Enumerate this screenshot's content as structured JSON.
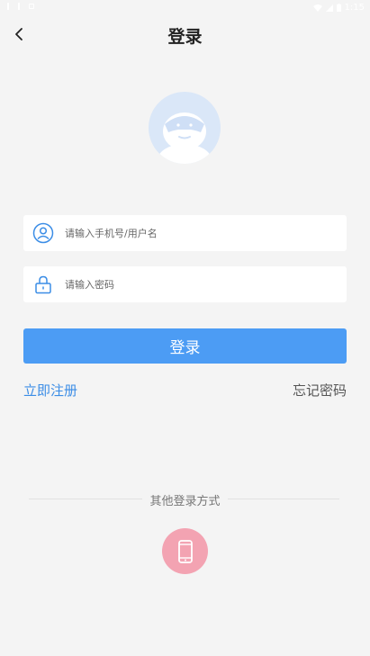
{
  "status_bar": {
    "time": "1:15"
  },
  "header": {
    "title": "登录"
  },
  "form": {
    "username": {
      "placeholder": "请输入手机号/用户名",
      "value": ""
    },
    "password": {
      "placeholder": "请输入密码",
      "value": ""
    },
    "login_label": "登录"
  },
  "links": {
    "register": "立即注册",
    "forgot": "忘记密码"
  },
  "other_login": {
    "label": "其他登录方式",
    "options": [
      {
        "icon": "phone-icon"
      }
    ]
  },
  "colors": {
    "accent": "#4c9cf4",
    "link": "#3b8de6",
    "phone_button": "#f3a3b2",
    "avatar_bg": "#dae7f8"
  }
}
